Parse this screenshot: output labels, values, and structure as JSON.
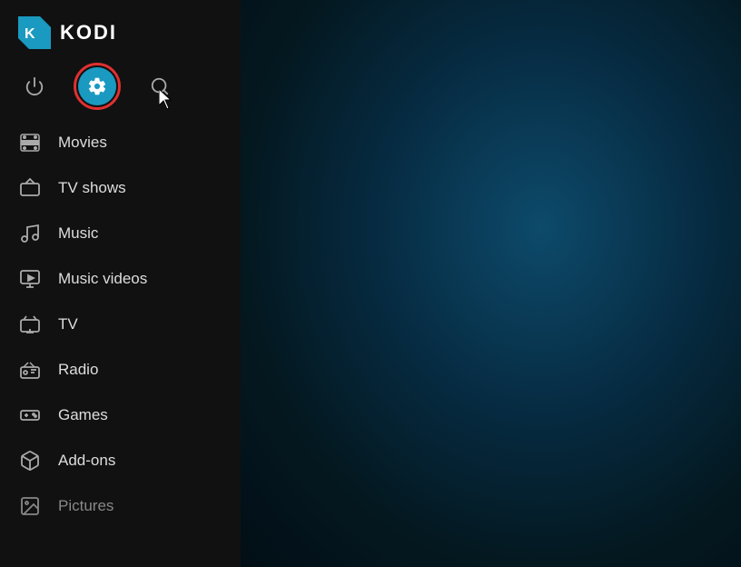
{
  "app": {
    "title": "KODI"
  },
  "top_icons": {
    "power_label": "Power",
    "settings_label": "Settings",
    "search_label": "Search"
  },
  "nav": {
    "items": [
      {
        "id": "movies",
        "label": "Movies",
        "icon": "movies"
      },
      {
        "id": "tv-shows",
        "label": "TV shows",
        "icon": "tv-shows"
      },
      {
        "id": "music",
        "label": "Music",
        "icon": "music"
      },
      {
        "id": "music-videos",
        "label": "Music videos",
        "icon": "music-videos"
      },
      {
        "id": "tv",
        "label": "TV",
        "icon": "tv"
      },
      {
        "id": "radio",
        "label": "Radio",
        "icon": "radio"
      },
      {
        "id": "games",
        "label": "Games",
        "icon": "games"
      },
      {
        "id": "add-ons",
        "label": "Add-ons",
        "icon": "add-ons"
      },
      {
        "id": "pictures",
        "label": "Pictures",
        "icon": "pictures"
      }
    ]
  },
  "colors": {
    "settings_bg": "#1a9ac0",
    "settings_outline": "#e03030",
    "sidebar_bg": "#111111",
    "main_bg_start": "#0d4a6b"
  }
}
